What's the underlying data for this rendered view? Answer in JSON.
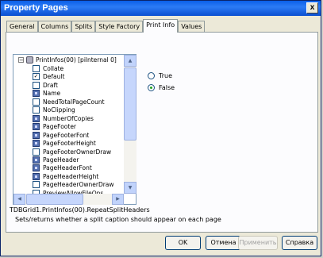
{
  "window": {
    "title": "Property Pages",
    "close_label": "x"
  },
  "tabs": [
    {
      "label": "General"
    },
    {
      "label": "Columns"
    },
    {
      "label": "Splits"
    },
    {
      "label": "Style Factory"
    },
    {
      "label": "Print Info"
    },
    {
      "label": "Values"
    }
  ],
  "active_tab": "Print Info",
  "tree": {
    "root": {
      "label": "PrintInfos(00) [pilnternal 0]",
      "expander": "−"
    },
    "items": [
      {
        "label": "Collate",
        "icon": "checkbox-icon",
        "checked": ""
      },
      {
        "label": "Default",
        "icon": "checkbox-icon",
        "checked": "✓"
      },
      {
        "label": "Draft",
        "icon": "checkbox-icon",
        "checked": ""
      },
      {
        "label": "Name",
        "icon": "property-icon"
      },
      {
        "label": "NeedTotalPageCount",
        "icon": "checkbox-icon",
        "checked": ""
      },
      {
        "label": "NoClipping",
        "icon": "checkbox-icon",
        "checked": ""
      },
      {
        "label": "NumberOfCopies",
        "icon": "property-icon"
      },
      {
        "label": "PageFooter",
        "icon": "property-icon"
      },
      {
        "label": "PageFooterFont",
        "icon": "property-icon"
      },
      {
        "label": "PageFooterHeight",
        "icon": "property-icon"
      },
      {
        "label": "PageFooterOwnerDraw",
        "icon": "checkbox-icon",
        "checked": ""
      },
      {
        "label": "PageHeader",
        "icon": "property-icon"
      },
      {
        "label": "PageHeaderFont",
        "icon": "property-icon"
      },
      {
        "label": "PageHeaderHeight",
        "icon": "property-icon"
      },
      {
        "label": "PageHeaderOwnerDraw",
        "icon": "checkbox-icon",
        "checked": ""
      },
      {
        "label": "PreviewAllowFileOps",
        "icon": "checkbox-icon",
        "checked": ""
      }
    ]
  },
  "options": [
    {
      "label": "True",
      "selected": false
    },
    {
      "label": "False",
      "selected": true
    }
  ],
  "status": {
    "path": "TDBGrid1.PrintInfos(00).RepeatSplitHeaders",
    "description": "Sets/returns whether a split caption should appear on each page"
  },
  "buttons": {
    "ok": "OK",
    "cancel": "Отмена",
    "apply": "Применить",
    "help": "Справка"
  }
}
